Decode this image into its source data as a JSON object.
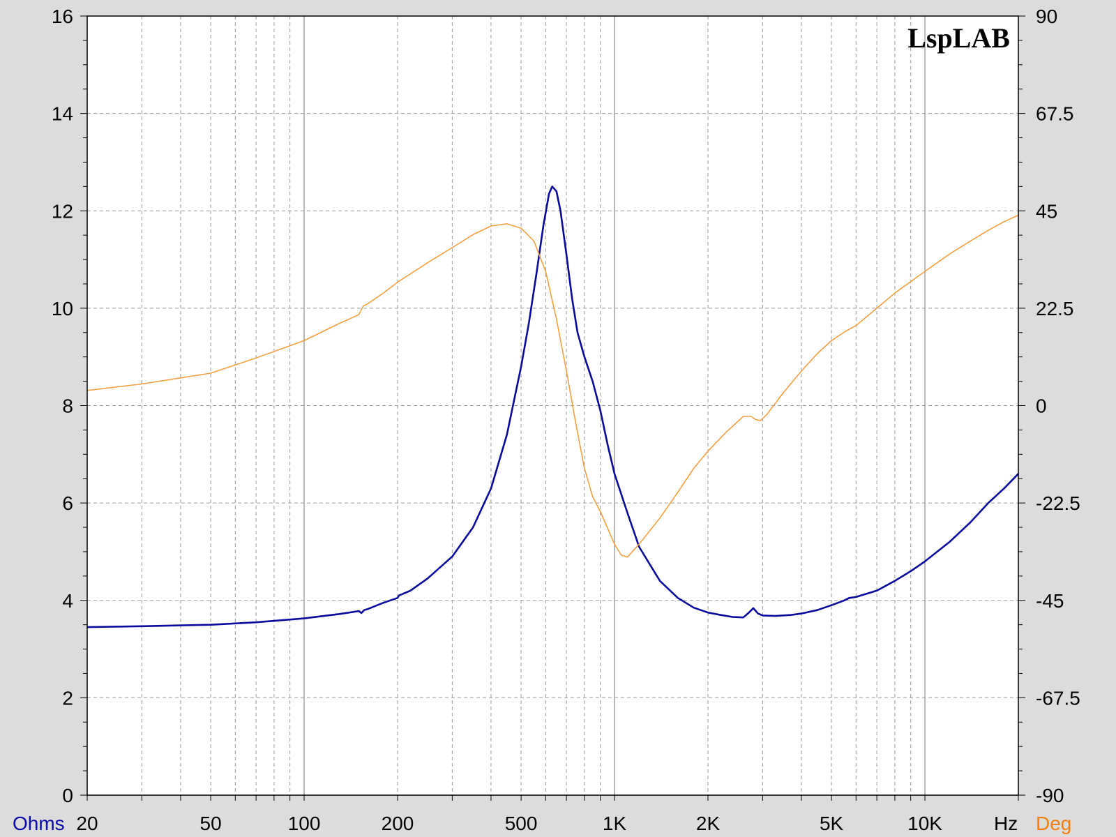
{
  "chart_data": {
    "type": "line",
    "title": "",
    "brand": "LspLAB",
    "x_unit_label": "Hz",
    "left_axis_label": "Ohms",
    "right_axis_label": "Deg",
    "x_scale": "log",
    "xlim": [
      20,
      20000
    ],
    "ylim_left": [
      0,
      16
    ],
    "ylim_right": [
      -90,
      90
    ],
    "grid": true,
    "x_ticks": [
      {
        "value": 20,
        "label": "20"
      },
      {
        "value": 50,
        "label": "50"
      },
      {
        "value": 100,
        "label": "100"
      },
      {
        "value": 200,
        "label": "200"
      },
      {
        "value": 500,
        "label": "500"
      },
      {
        "value": 1000,
        "label": "1K"
      },
      {
        "value": 2000,
        "label": "2K"
      },
      {
        "value": 5000,
        "label": "5K"
      },
      {
        "value": 10000,
        "label": "10K"
      }
    ],
    "y_left_ticks": [
      {
        "value": 0,
        "label": "0"
      },
      {
        "value": 2,
        "label": "2"
      },
      {
        "value": 4,
        "label": "4"
      },
      {
        "value": 6,
        "label": "6"
      },
      {
        "value": 8,
        "label": "8"
      },
      {
        "value": 10,
        "label": "10"
      },
      {
        "value": 12,
        "label": "12"
      },
      {
        "value": 14,
        "label": "14"
      },
      {
        "value": 16,
        "label": "16"
      }
    ],
    "y_right_ticks": [
      {
        "value": -90,
        "label": "-90"
      },
      {
        "value": -67.5,
        "label": "-67.5"
      },
      {
        "value": -45,
        "label": "-45"
      },
      {
        "value": -22.5,
        "label": "-22.5"
      },
      {
        "value": 0,
        "label": "0"
      },
      {
        "value": 22.5,
        "label": "22.5"
      },
      {
        "value": 45,
        "label": "45"
      },
      {
        "value": 67.5,
        "label": "67.5"
      },
      {
        "value": 90,
        "label": "90"
      }
    ],
    "series": [
      {
        "axis": "left",
        "color": "#0a0a9e",
        "x": [
          20,
          30,
          50,
          70,
          100,
          130,
          150,
          153,
          156,
          160,
          180,
          200,
          202,
          220,
          250,
          300,
          350,
          400,
          450,
          500,
          530,
          560,
          590,
          615,
          630,
          650,
          670,
          700,
          730,
          760,
          800,
          850,
          900,
          950,
          1000,
          1100,
          1200,
          1400,
          1600,
          1800,
          2000,
          2200,
          2400,
          2600,
          2700,
          2800,
          2900,
          3000,
          3300,
          3700,
          4000,
          4500,
          5000,
          5500,
          5700,
          6000,
          7000,
          8000,
          9000,
          10000,
          12000,
          14000,
          16000,
          18000,
          20000
        ],
        "values": [
          3.45,
          3.47,
          3.5,
          3.55,
          3.63,
          3.72,
          3.78,
          3.74,
          3.8,
          3.82,
          3.95,
          4.05,
          4.1,
          4.2,
          4.45,
          4.9,
          5.5,
          6.3,
          7.4,
          8.8,
          9.7,
          10.7,
          11.7,
          12.35,
          12.5,
          12.4,
          12.0,
          11.1,
          10.2,
          9.5,
          9.0,
          8.5,
          7.9,
          7.2,
          6.6,
          5.8,
          5.1,
          4.4,
          4.05,
          3.85,
          3.75,
          3.7,
          3.66,
          3.65,
          3.74,
          3.84,
          3.73,
          3.69,
          3.68,
          3.7,
          3.73,
          3.8,
          3.9,
          4.0,
          4.05,
          4.07,
          4.2,
          4.4,
          4.6,
          4.8,
          5.2,
          5.6,
          6.0,
          6.3,
          6.6
        ]
      },
      {
        "axis": "right",
        "color": "#f5a040",
        "x": [
          20,
          30,
          50,
          70,
          100,
          130,
          150,
          155,
          160,
          180,
          200,
          250,
          300,
          350,
          400,
          450,
          500,
          550,
          600,
          650,
          700,
          750,
          800,
          850,
          900,
          1000,
          1050,
          1100,
          1200,
          1400,
          1600,
          1800,
          2000,
          2300,
          2600,
          2750,
          2850,
          2950,
          3100,
          3500,
          4000,
          4500,
          5000,
          5500,
          6000,
          7000,
          8000,
          10000,
          12000,
          14000,
          16000,
          18000,
          20000
        ],
        "values": [
          3.5,
          5,
          7.5,
          11,
          15,
          19,
          21,
          23,
          23.5,
          26,
          28.5,
          33,
          36.5,
          39.5,
          41.5,
          42.0,
          41.0,
          38.0,
          31.0,
          20.0,
          8.0,
          -4.0,
          -14.5,
          -21.0,
          -24.5,
          -32.0,
          -34.5,
          -35.0,
          -32.0,
          -26.0,
          -20.0,
          -14.5,
          -10.5,
          -6.0,
          -2.5,
          -2.5,
          -3.2,
          -3.5,
          -2.0,
          3.0,
          8.0,
          12.0,
          15.0,
          17.0,
          18.5,
          22.5,
          26.0,
          31.0,
          35.0,
          38.0,
          40.5,
          42.5,
          44.0
        ]
      }
    ]
  }
}
